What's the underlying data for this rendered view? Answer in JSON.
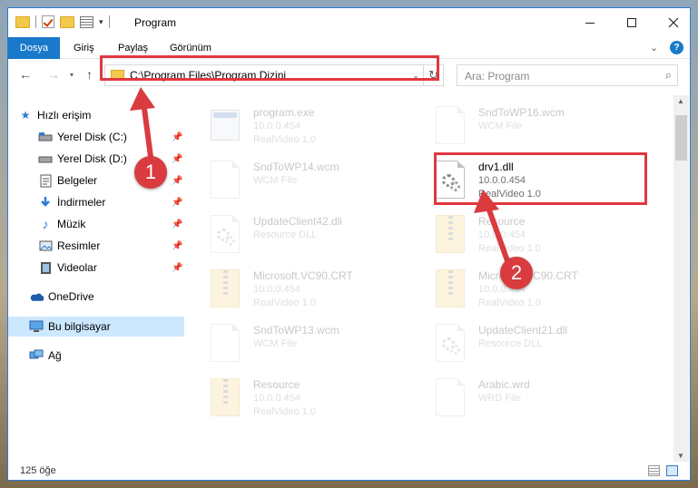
{
  "window": {
    "title": "Program",
    "qat_dropdown": "▾"
  },
  "ribbon": {
    "tabs": [
      "Dosya",
      "Giriş",
      "Paylaş",
      "Görünüm"
    ],
    "help": "?"
  },
  "nav": {
    "address": "C:\\Program Files\\Program Dizini",
    "search_placeholder": "Ara: Program"
  },
  "sidebar": {
    "items": [
      {
        "label": "Hızlı erişim",
        "icon": "star-icon"
      },
      {
        "label": "Yerel Disk (C:)",
        "icon": "drive-icon",
        "pinned": true
      },
      {
        "label": "Yerel Disk (D:)",
        "icon": "drive-icon",
        "pinned": true
      },
      {
        "label": "Belgeler",
        "icon": "documents-icon",
        "pinned": true
      },
      {
        "label": "İndirmeler",
        "icon": "download-icon",
        "pinned": true
      },
      {
        "label": "Müzik",
        "icon": "music-icon",
        "pinned": true
      },
      {
        "label": "Resimler",
        "icon": "pictures-icon",
        "pinned": true
      },
      {
        "label": "Videolar",
        "icon": "video-icon",
        "pinned": true
      },
      {
        "label": "OneDrive",
        "icon": "cloud-icon"
      },
      {
        "label": "Bu bilgisayar",
        "icon": "computer-icon",
        "selected": true
      },
      {
        "label": "Ağ",
        "icon": "network-icon"
      }
    ]
  },
  "files": [
    {
      "name": "program.exe",
      "line2": "10.0.0.454",
      "line3": "RealVideo 1.0",
      "icon": "exe"
    },
    {
      "name": "SndToWP16.wcm",
      "line2": "WCM File",
      "line3": "",
      "icon": "doc"
    },
    {
      "name": "SndToWP14.wcm",
      "line2": "WCM File",
      "line3": "",
      "icon": "doc"
    },
    {
      "name": "drv1.dll",
      "line2": "10.0.0.454",
      "line3": "RealVideo 1.0",
      "icon": "dll",
      "highlight": true
    },
    {
      "name": "UpdateClient42.dll",
      "line2": "Resource DLL",
      "line3": "",
      "icon": "dll"
    },
    {
      "name": "Resource",
      "line2": "10.0.0.454",
      "line3": "RealVideo 1.0",
      "icon": "zip"
    },
    {
      "name": "Microsoft.VC90.CRT",
      "line2": "10.0.0.454",
      "line3": "RealVideo 1.0",
      "icon": "zip"
    },
    {
      "name": "Microsoft.VC90.CRT",
      "line2": "10.0.0.454",
      "line3": "RealVideo 1.0",
      "icon": "zip"
    },
    {
      "name": "SndToWP13.wcm",
      "line2": "WCM File",
      "line3": "",
      "icon": "doc"
    },
    {
      "name": "UpdateClient21.dll",
      "line2": "Resource DLL",
      "line3": "",
      "icon": "dll"
    },
    {
      "name": "Resource",
      "line2": "10.0.0.454",
      "line3": "RealVideo 1.0",
      "icon": "zip"
    },
    {
      "name": "Arabic.wrd",
      "line2": "WRD File",
      "line3": "",
      "icon": "doc"
    }
  ],
  "status": {
    "count": "125 öğe"
  },
  "callouts": {
    "one": "1",
    "two": "2"
  },
  "colors": {
    "accent": "#1979ca",
    "callout_red": "#d93b3f",
    "selection": "#cce8ff"
  }
}
